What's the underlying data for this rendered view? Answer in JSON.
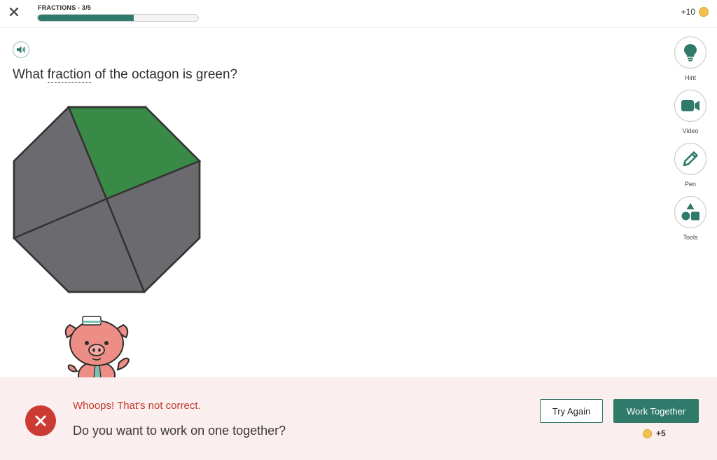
{
  "header": {
    "close_glyph": "✕",
    "progress_label": "FRACTIONS - 3/5",
    "progress_fraction": 0.6,
    "coins_label": "+10",
    "progress_color": "#2f7a6a"
  },
  "question": {
    "prefix": "What ",
    "term": "fraction",
    "suffix": " of the octagon is green?"
  },
  "figure": {
    "shape": "octagon",
    "total_parts": 4,
    "shaded_parts": 1,
    "shaded_color": "#3a8a47",
    "unshaded_color": "#6b6b6f"
  },
  "tools": [
    {
      "name": "hint",
      "label": "Hint",
      "icon": "lightbulb-icon"
    },
    {
      "name": "video",
      "label": "Video",
      "icon": "video-camera-icon"
    },
    {
      "name": "pen",
      "label": "Pen",
      "icon": "pencil-icon"
    },
    {
      "name": "tools",
      "label": "Tools",
      "icon": "shapes-icon"
    }
  ],
  "feedback": {
    "title": "Whoops! That's not correct.",
    "subtitle": "Do you want to work on one together?",
    "try_again_label": "Try Again",
    "work_together_label": "Work Together",
    "reward_label": "+5",
    "error_color": "#cc3b33",
    "accent_color": "#2f7a6a"
  }
}
